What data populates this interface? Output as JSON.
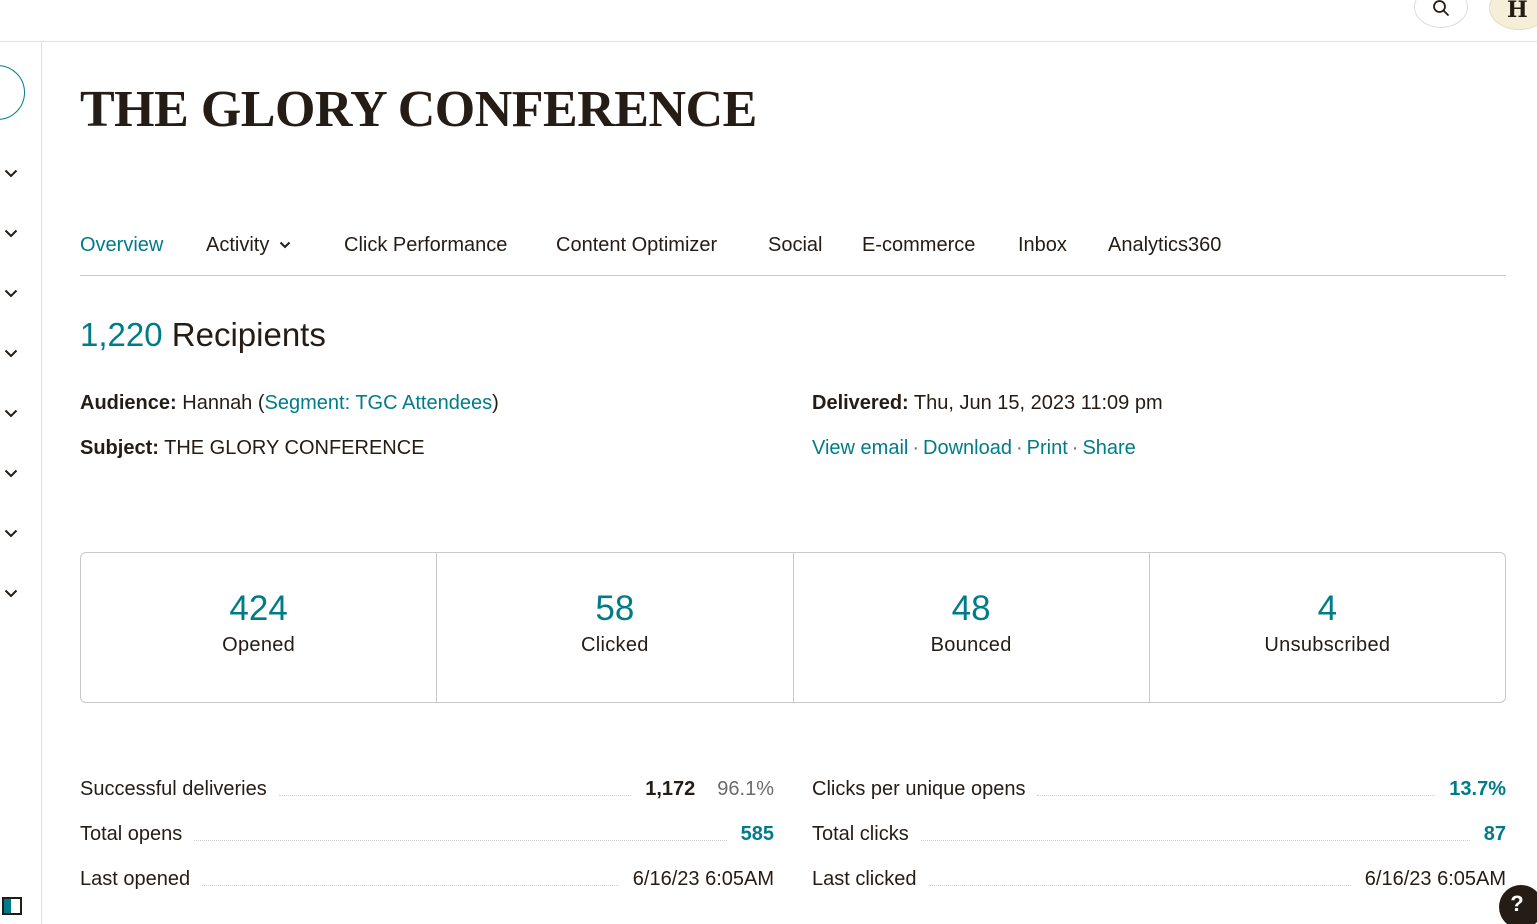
{
  "header": {
    "search_icon": "search-icon",
    "avatar_initial": "H"
  },
  "rail": {
    "icons": [
      "chevron-down-icon",
      "chevron-down-icon",
      "chevron-down-icon",
      "chevron-down-icon",
      "chevron-down-icon",
      "chevron-down-icon",
      "chevron-down-icon",
      "chevron-down-icon"
    ]
  },
  "page": {
    "title": "THE GLORY CONFERENCE"
  },
  "tabs": {
    "overview": "Overview",
    "activity": "Activity",
    "click_performance": "Click Performance",
    "content_optimizer": "Content Optimizer",
    "social": "Social",
    "ecommerce": "E-commerce",
    "inbox": "Inbox",
    "analytics360": "Analytics360"
  },
  "summary": {
    "recipients_count": "1,220",
    "recipients_label": "Recipients",
    "audience_label": "Audience:",
    "audience_name": "Hannah (",
    "segment_link": "Segment: TGC Attendees",
    "audience_close": ")",
    "subject_label": "Subject:",
    "subject_value": "THE GLORY CONFERENCE",
    "delivered_label": "Delivered:",
    "delivered_value": "Thu, Jun 15, 2023 11:09 pm",
    "actions": {
      "view_email": "View email",
      "download": "Download",
      "print": "Print",
      "share": "Share",
      "separator": "·"
    }
  },
  "stats": [
    {
      "value": "424",
      "label": "Opened"
    },
    {
      "value": "58",
      "label": "Clicked"
    },
    {
      "value": "48",
      "label": "Bounced"
    },
    {
      "value": "4",
      "label": "Unsubscribed"
    }
  ],
  "details": {
    "left": [
      {
        "label": "Successful deliveries",
        "value": "1,172",
        "pct": "96.1%"
      },
      {
        "label": "Total opens",
        "value": "585"
      },
      {
        "label": "Last opened",
        "value": "6/16/23 6:05AM"
      }
    ],
    "right": [
      {
        "label": "Clicks per unique opens",
        "value": "13.7%"
      },
      {
        "label": "Total clicks",
        "value": "87"
      },
      {
        "label": "Last clicked",
        "value": "6/16/23 6:05AM"
      }
    ]
  },
  "help": {
    "label": "?"
  },
  "colors": {
    "accent": "#007c89",
    "text": "#241c15",
    "border": "#c9c9c9"
  }
}
